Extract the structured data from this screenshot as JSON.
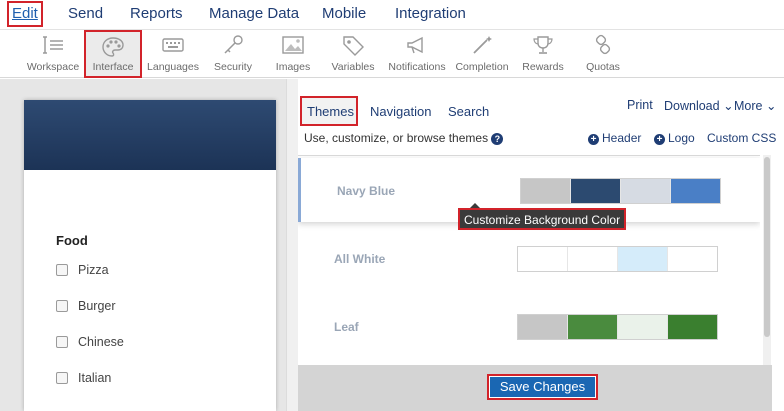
{
  "topmenu": {
    "items": [
      "Edit",
      "Send",
      "Reports",
      "Manage Data",
      "Mobile",
      "Integration"
    ]
  },
  "toolbar": {
    "items": [
      {
        "label": "Workspace",
        "icon": "workspace-icon"
      },
      {
        "label": "Interface",
        "icon": "palette-icon"
      },
      {
        "label": "Languages",
        "icon": "keyboard-icon"
      },
      {
        "label": "Security",
        "icon": "key-icon"
      },
      {
        "label": "Images",
        "icon": "image-icon"
      },
      {
        "label": "Variables",
        "icon": "tag-icon"
      },
      {
        "label": "Notifications",
        "icon": "megaphone-icon"
      },
      {
        "label": "Completion",
        "icon": "magic-wand-icon"
      },
      {
        "label": "Rewards",
        "icon": "trophy-icon"
      },
      {
        "label": "Quotas",
        "icon": "quota-icon"
      }
    ]
  },
  "preview": {
    "question": "Food",
    "options": [
      "Pizza",
      "Burger",
      "Chinese",
      "Italian"
    ]
  },
  "panel": {
    "tabs": [
      "Themes",
      "Navigation",
      "Search"
    ],
    "links": {
      "print": "Print",
      "download": "Download ⌄",
      "more": "More ⌄"
    },
    "subtitle": "Use, customize, or browse themes",
    "add_header": "Header",
    "add_logo": "Logo",
    "custom_css": "Custom CSS",
    "themes": [
      {
        "name": "Navy Blue",
        "colors": [
          "#c6c6c6",
          "#2c4a70",
          "#d6dbe3",
          "#4a7fc6"
        ]
      },
      {
        "name": "All White",
        "colors": [
          "#ffffff",
          "#ffffff",
          "#d5ecfa",
          "#ffffff"
        ]
      },
      {
        "name": "Leaf",
        "colors": [
          "#c6c6c6",
          "#4a8b3e",
          "#eaf2ea",
          "#3a7f2f"
        ]
      }
    ],
    "tooltip": "Customize Background Color",
    "save_label": "Save Changes"
  },
  "colors": {
    "accent": "#1f3d74",
    "highlight": "#d2232a",
    "save": "#1a67b3"
  }
}
